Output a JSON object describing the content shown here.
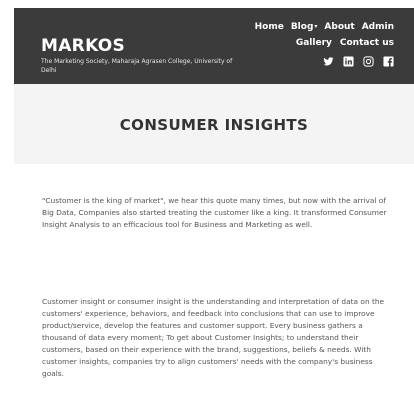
{
  "header": {
    "brand_title": "MARKOS",
    "brand_subtitle": "The Marketing Society, Maharaja Agrasen College, University of Delhi",
    "nav_row1": [
      "Home",
      "Blog",
      "About",
      "Admin"
    ],
    "blog_caret": "▾",
    "nav_row2": [
      "Gallery",
      "Contact us"
    ],
    "social_icons": [
      "twitter-icon",
      "linkedin-icon",
      "instagram-icon",
      "facebook-icon"
    ]
  },
  "hero": {
    "title": "CONSUMER INSIGHTS"
  },
  "article": {
    "paragraphs": [
      "\"Customer is the king of market\", we hear this quote many times, but now with the arrival of Big Data, Companies also started treating the customer like a king. It transformed Consumer Insight Analysis to an efficacious tool for Business and Marketing as well.",
      "Customer insight or consumer insight is the understanding and interpretation of data on the customers' experience, behaviors, and feedback into conclusions that can use to improve product/service, develop the features and customer support. Every business gathers a thousand of data every moment; To get about Customer Insights; to understand their customers, based on their experience with the brand, suggestions, beliefs & needs. With customer insights, companies try to align customers' needs with the company's business goals."
    ]
  },
  "colors": {
    "header_bg": "#3b3b3b",
    "hero_bg": "#f4f4f4",
    "text": "#555555"
  }
}
